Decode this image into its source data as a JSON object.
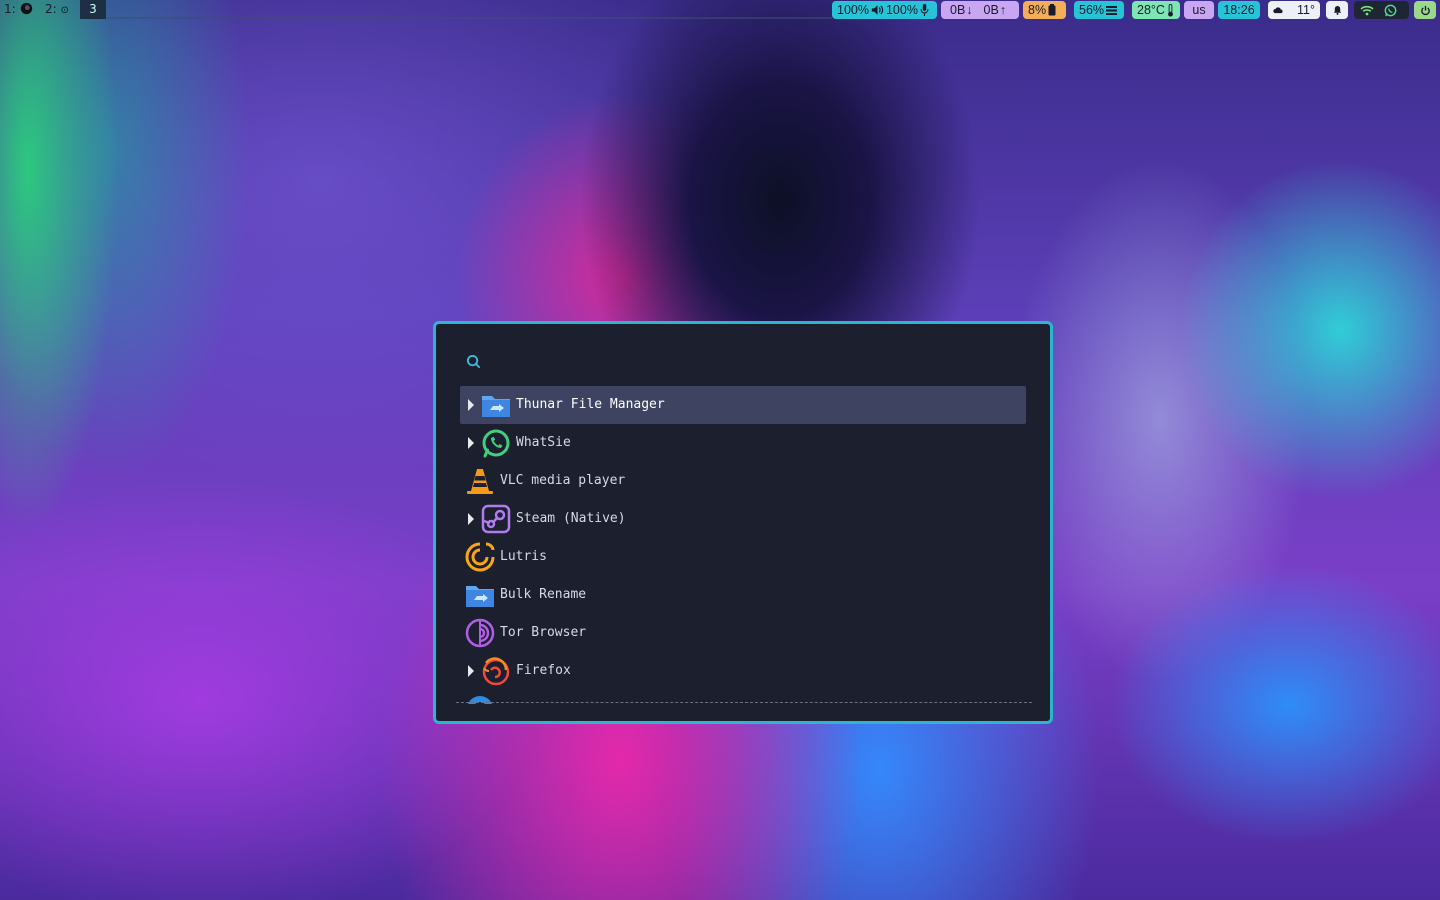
{
  "workspaces": [
    {
      "label": "1:",
      "icon": "firefox-icon"
    },
    {
      "label": "2:",
      "icon": "terminal-icon"
    },
    {
      "label": "3",
      "active": true
    }
  ],
  "status": {
    "audio": {
      "volume": "100%",
      "mic": "100%"
    },
    "network": {
      "down": "0B",
      "down_arrow": "↓",
      "up": "0B",
      "up_arrow": "↑"
    },
    "battery": "8%",
    "memory": "56%",
    "temperature": "28°C",
    "keyboard_layout": "us",
    "clock": "18:26",
    "weather": "11°",
    "colors": {
      "audio": "#27c3d6",
      "network": "#c9a6f2",
      "battery": "#f2ae58",
      "memory": "#27c3d6",
      "temperature": "#7ee6b4",
      "keyboard": "#c9a6f2",
      "clock": "#27c3d6",
      "weather": "#eef0f8",
      "tray": "#9ad88a"
    }
  },
  "launcher": {
    "search": {
      "value": "",
      "placeholder": ""
    },
    "border_color": "#2bb6d0",
    "background": "#1c1f2d",
    "selected_bg": "#3d4360",
    "entries": [
      {
        "label": "Thunar File Manager",
        "icon": "folder-icon",
        "expandable": true,
        "selected": true
      },
      {
        "label": "WhatSie",
        "icon": "whatsapp-icon",
        "expandable": true
      },
      {
        "label": "VLC media player",
        "icon": "vlc-cone-icon",
        "expandable": false
      },
      {
        "label": "Steam (Native)",
        "icon": "steam-icon",
        "expandable": true
      },
      {
        "label": "Lutris",
        "icon": "lutris-icon",
        "expandable": false
      },
      {
        "label": "Bulk Rename",
        "icon": "bulk-rename-folder-icon",
        "expandable": false
      },
      {
        "label": "Tor Browser",
        "icon": "tor-icon",
        "expandable": false
      },
      {
        "label": "Firefox",
        "icon": "firefox-icon",
        "expandable": true
      }
    ]
  }
}
